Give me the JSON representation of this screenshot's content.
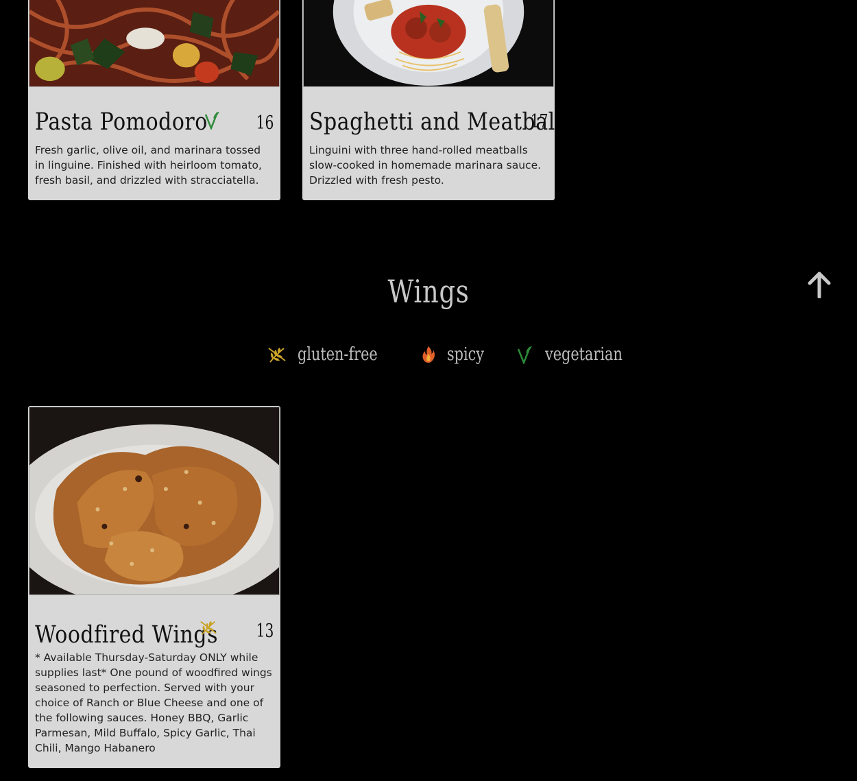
{
  "sections": {
    "pasta": {
      "items": [
        {
          "name": "Pasta Pomodoro",
          "price": "16",
          "diet": "vegetarian",
          "description": "Fresh garlic, olive oil, and marinara tossed in linguine. Finished with heirloom tomato, fresh basil, and drizzled with stracciatella."
        },
        {
          "name": "Spaghetti and Meatballs",
          "price": "17",
          "diet": "",
          "description": "Linguini with three hand-rolled meatballs slow-cooked in homemade marinara sauce. Drizzled with fresh pesto."
        }
      ]
    },
    "wings": {
      "title": "Wings",
      "legend": [
        {
          "icon": "wheat-slash-icon",
          "label": "gluten-free",
          "color": "#c9a227"
        },
        {
          "icon": "flame-icon",
          "label": "spicy",
          "color": "#e0602a"
        },
        {
          "icon": "leaf-v-icon",
          "label": "vegetarian",
          "color": "#2e8b3a"
        }
      ],
      "items": [
        {
          "name": "Woodfired Wings",
          "price": "13",
          "diet": "gluten-free",
          "description": "* Available Thursday-Saturday ONLY while supplies last* One pound of woodfired wings seasoned to perfection. Served with your choice of Ranch or Blue Cheese and one of the following sauces. Honey BBQ, Garlic Parmesan, Mild Buffalo, Spicy Garlic, Thai Chili, Mango Habanero"
        }
      ]
    }
  },
  "back_to_top_icon": "arrow-up-icon"
}
